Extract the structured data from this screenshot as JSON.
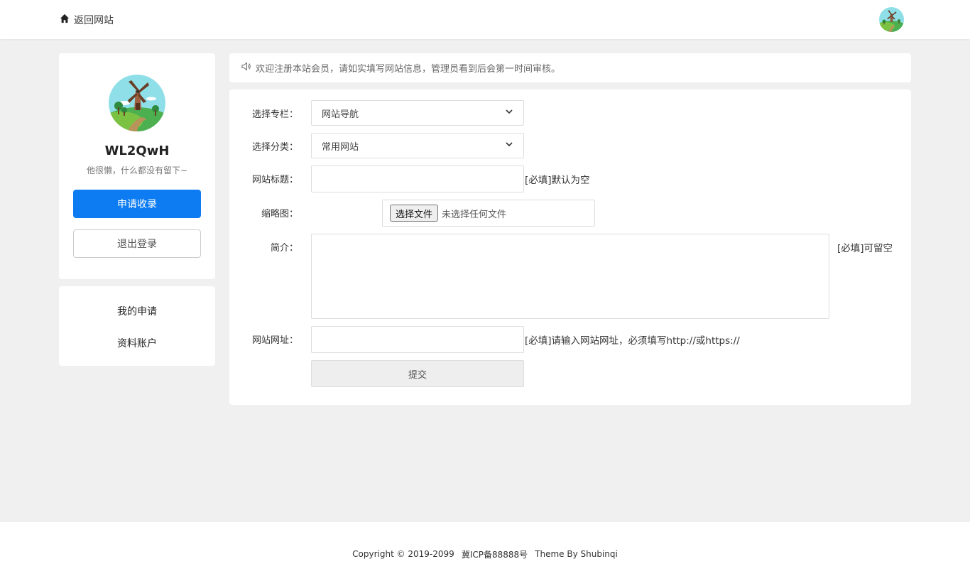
{
  "header": {
    "back_label": "返回网站",
    "home_icon": "home-icon"
  },
  "profile": {
    "username": "WL2QwH",
    "bio": "他很懒，什么都没有留下~",
    "apply_label": "申请收录",
    "logout_label": "退出登录",
    "accent_color": "#0d7cf2"
  },
  "menu": {
    "items": [
      {
        "label": "我的申请"
      },
      {
        "label": "资料账户"
      }
    ]
  },
  "notice": {
    "icon": "speaker-icon",
    "text": "欢迎注册本站会员，请如实填写网站信息，管理员看到后会第一时间审核。"
  },
  "form": {
    "column_label": "选择专栏：",
    "column_value": "网站导航",
    "category_label": "选择分类：",
    "category_value": "常用网站",
    "title_label": "网站标题：",
    "title_value": "",
    "title_hint": "[必填]默认为空",
    "thumb_label": "缩略图：",
    "file_button": "选择文件",
    "file_status": "未选择任何文件",
    "intro_label": "简介：",
    "intro_value": "",
    "intro_hint": "[必填]可留空",
    "url_label": "网站网址：",
    "url_value": "",
    "url_hint": "[必填]请输入网站网址，必须填写http://或https://",
    "submit_label": "提交"
  },
  "footer": {
    "copyright": "Copyright © 2019-2099",
    "icp": "冀ICP备88888号",
    "theme": "Theme By Shubinqi"
  }
}
